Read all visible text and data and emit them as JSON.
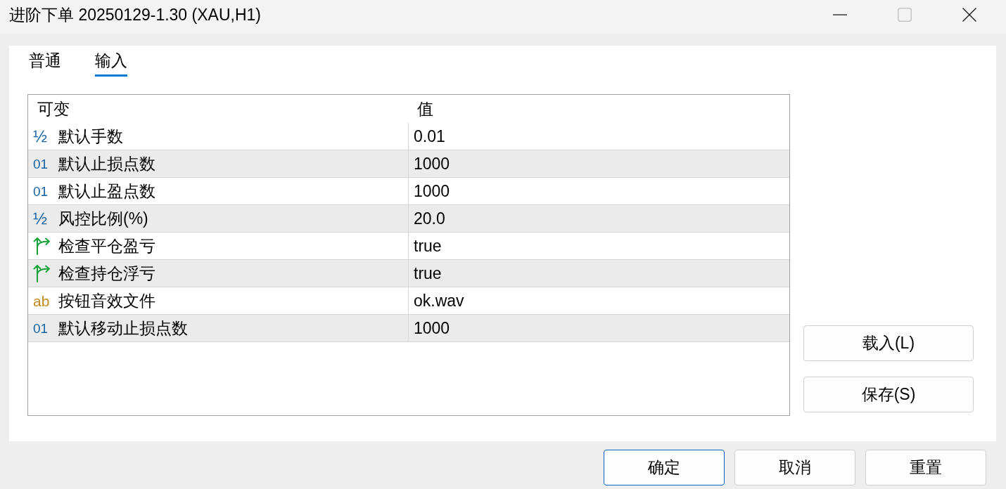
{
  "window": {
    "title": "进阶下单 20250129-1.30 (XAU,H1)",
    "controls": [
      {
        "kind": "minimize",
        "disabled": false
      },
      {
        "kind": "maximize",
        "disabled": true
      },
      {
        "kind": "close",
        "disabled": false
      }
    ]
  },
  "tabs": [
    {
      "label": "普通",
      "selected": false
    },
    {
      "label": "输入",
      "selected": true
    }
  ],
  "table": {
    "columns": [
      "可变",
      "值"
    ],
    "rows": [
      {
        "kind": "double",
        "icon": "½",
        "name": "默认手数",
        "value": "0.01",
        "selected": false
      },
      {
        "kind": "int",
        "icon": "01",
        "name": "默认止损点数",
        "value": "1000",
        "selected": false
      },
      {
        "kind": "int",
        "icon": "01",
        "name": "默认止盈点数",
        "value": "1000",
        "selected": false
      },
      {
        "kind": "double",
        "icon": "½",
        "name": "风控比例(%)",
        "value": "20.0",
        "selected": false
      },
      {
        "kind": "bool",
        "name": "检查平仓盈亏",
        "value": "true",
        "selected": false
      },
      {
        "kind": "bool",
        "name": "检查持仓浮亏",
        "value": "true",
        "selected": false
      },
      {
        "kind": "string",
        "icon": "ab",
        "name": "按钮音效文件",
        "value": "ok.wav",
        "selected": false
      },
      {
        "kind": "int",
        "icon": "01",
        "name": "默认移动止损点数",
        "value": "1000",
        "selected": false
      }
    ]
  },
  "side_buttons": [
    "载入(L)",
    "保存(S)"
  ],
  "dialog_buttons": [
    {
      "label": "确定",
      "default": true
    },
    {
      "label": "取消",
      "default": false
    },
    {
      "label": "重置",
      "default": false
    }
  ]
}
